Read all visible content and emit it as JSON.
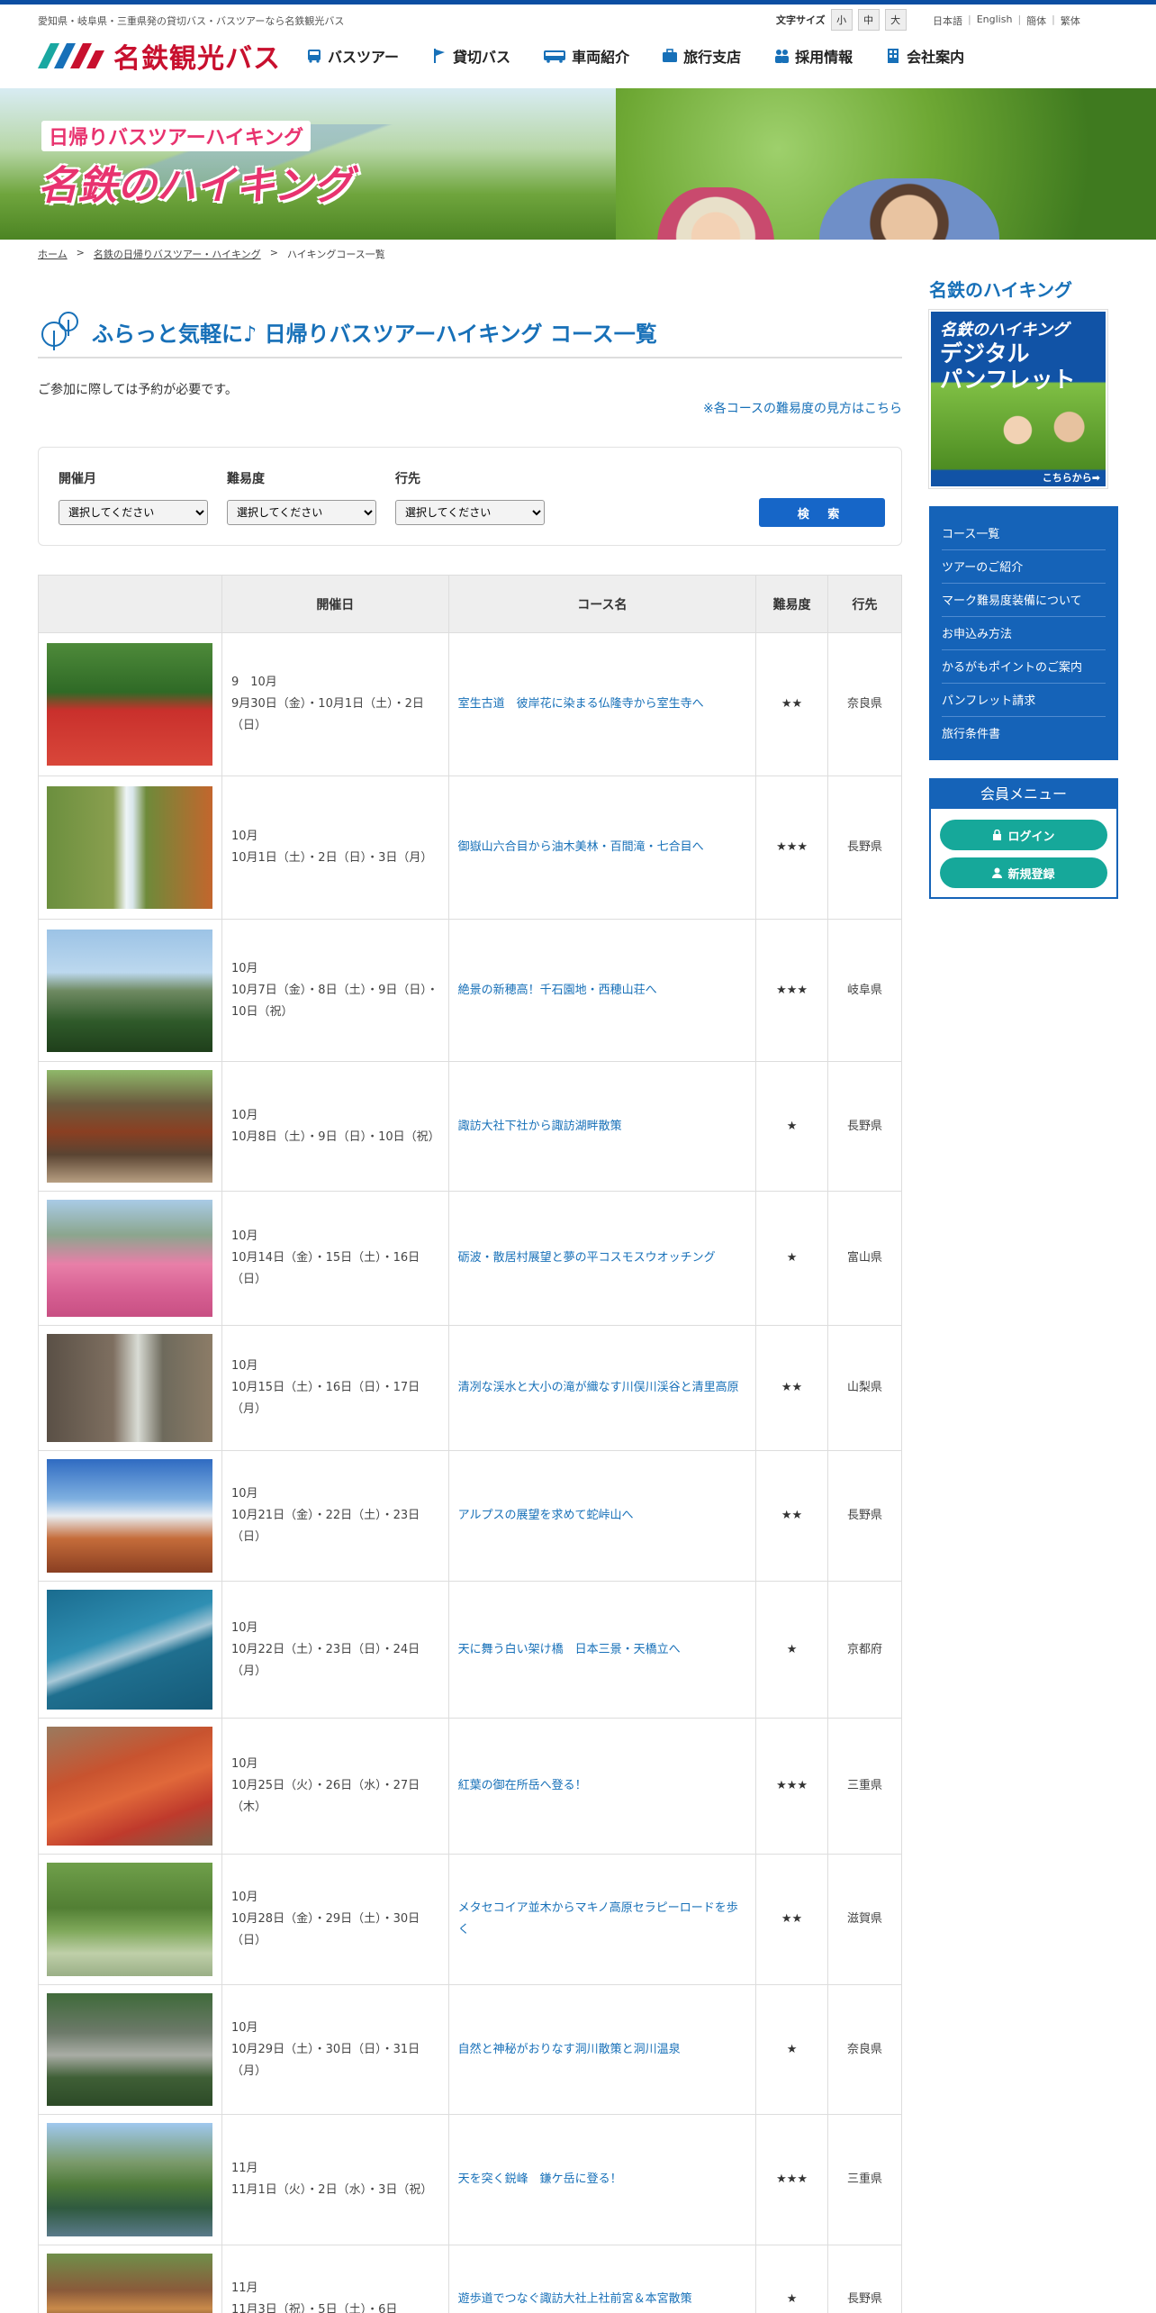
{
  "header": {
    "tagline": "愛知県・岐阜県・三重県発の貸切バス・バスツアーなら名鉄観光バス",
    "font_size_label": "文字サイズ",
    "font_sizes": [
      "小",
      "中",
      "大"
    ],
    "languages": [
      "日本語",
      "English",
      "簡体",
      "繁体"
    ],
    "logo_text": "名鉄観光バス",
    "nav": [
      "バスツアー",
      "貸切バス",
      "車両紹介",
      "旅行支店",
      "採用情報",
      "会社案内"
    ]
  },
  "hero": {
    "subtitle": "日帰りバスツアーハイキング",
    "title": "名鉄のハイキング"
  },
  "breadcrumb": [
    "ホーム",
    "名鉄の日帰りバスツアー・ハイキング",
    "ハイキングコース一覧"
  ],
  "main": {
    "title": "ふらっと気軽に♪ 日帰りバスツアーハイキング コース一覧",
    "note": "ご参加に際しては予約が必要です。",
    "difficulty_link": "※各コースの難易度の見方はこちら"
  },
  "search": {
    "month_label": "開催月",
    "difficulty_label": "難易度",
    "destination_label": "行先",
    "select_placeholder": "選択してください",
    "button": "検 索"
  },
  "table": {
    "headers": [
      "",
      "開催日",
      "コース名",
      "難易度",
      "行先"
    ],
    "rows": [
      {
        "date": "9　10月\n9月30日（金）・10月1日（土）・2日（日）",
        "name": "室生古道　彼岸花に染まる仏隆寺から室生寺へ",
        "difficulty": "★★",
        "dest": "奈良県"
      },
      {
        "date": "10月\n10月1日（土）・2日（日）・3日（月）",
        "name": "御嶽山六合目から油木美林・百間滝・七合目へ",
        "difficulty": "★★★",
        "dest": "長野県"
      },
      {
        "date": "10月\n10月7日（金）・8日（土）・9日（日）・10日（祝）",
        "name": "絶景の新穂高！千石園地・西穂山荘へ",
        "difficulty": "★★★",
        "dest": "岐阜県"
      },
      {
        "date": "10月\n10月8日（土）・9日（日）・10日（祝）",
        "name": "諏訪大社下社から諏訪湖畔散策",
        "difficulty": "★",
        "dest": "長野県"
      },
      {
        "date": "10月\n10月14日（金）・15日（土）・16日（日）",
        "name": "砺波・散居村展望と夢の平コスモスウオッチング",
        "difficulty": "★",
        "dest": "富山県"
      },
      {
        "date": "10月\n10月15日（土）・16日（日）・17日（月）",
        "name": "清冽な渓水と大小の滝が織なす川俣川渓谷と清里高原",
        "difficulty": "★★",
        "dest": "山梨県"
      },
      {
        "date": "10月\n10月21日（金）・22日（土）・23日（日）",
        "name": "アルプスの展望を求めて蛇峠山へ",
        "difficulty": "★★",
        "dest": "長野県"
      },
      {
        "date": "10月\n10月22日（土）・23日（日）・24日（月）",
        "name": "天に舞う白い架け橋　日本三景・天橋立へ",
        "difficulty": "★",
        "dest": "京都府"
      },
      {
        "date": "10月\n10月25日（火）・26日（水）・27日（木）",
        "name": "紅葉の御在所岳へ登る！",
        "difficulty": "★★★",
        "dest": "三重県"
      },
      {
        "date": "10月\n10月28日（金）・29日（土）・30日（日）",
        "name": "メタセコイア並木からマキノ高原セラピーロードを歩く",
        "difficulty": "★★",
        "dest": "滋賀県"
      },
      {
        "date": "10月\n10月29日（土）・30日（日）・31日（月）",
        "name": "自然と神秘がおりなす洞川散策と洞川温泉",
        "difficulty": "★",
        "dest": "奈良県"
      },
      {
        "date": "11月\n11月1日（火）・2日（水）・3日（祝）",
        "name": "天を突く鋭峰　鎌ケ岳に登る！",
        "difficulty": "★★★",
        "dest": "三重県"
      },
      {
        "date": "11月\n11月3日（祝）・5日（土）・6日",
        "name": "遊歩道でつなぐ諏訪大社上社前宮＆本宮散策",
        "difficulty": "★",
        "dest": "長野県"
      }
    ]
  },
  "sidebar": {
    "title": "名鉄のハイキング",
    "pamphlet_line1": "名鉄のハイキング",
    "pamphlet_line2": "デジタル\nパンフレット",
    "pamphlet_link": "こちらから➡",
    "menu": [
      "コース一覧",
      "ツアーのご紹介",
      "マーク難易度装備について",
      "お申込み方法",
      "かるがもポイントのご案内",
      "パンフレット請求",
      "旅行条件書"
    ],
    "member_title": "会員メニュー",
    "login": "ログイン",
    "register": "新規登録"
  },
  "colors": {
    "brand_blue": "#1770b8",
    "brand_red": "#c8102e",
    "hero_pink": "#e8336f",
    "member_green": "#16a89a"
  }
}
